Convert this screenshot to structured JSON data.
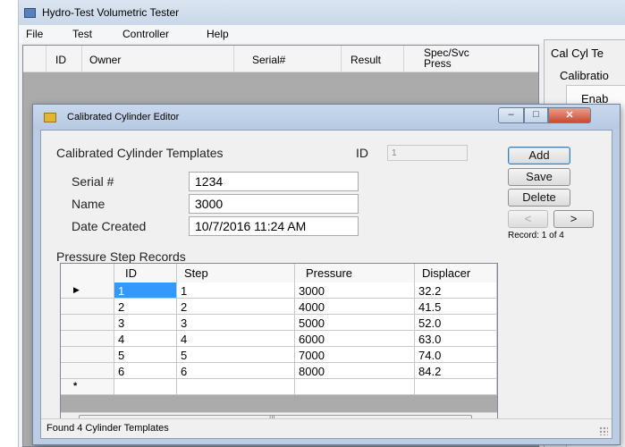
{
  "main_window": {
    "title": "Hydro-Test Volumetric Tester",
    "menu": [
      "File",
      "Test",
      "Controller",
      "Help"
    ],
    "grid_headers": [
      "ID",
      "Owner",
      "Serial#",
      "Result",
      "Spec/Svc Press"
    ],
    "right_panel": {
      "title": "Cal Cyl Te",
      "subtitle": "Calibratio",
      "enable_label": "Enab"
    }
  },
  "dialog": {
    "title": "Calibrated Cylinder Editor",
    "window_controls": {
      "minimize": "–",
      "maximize": "□",
      "close": "✕"
    },
    "section_title": "Calibrated Cylinder Templates",
    "id_label": "ID",
    "id_value": "1",
    "fields": {
      "serial_label": "Serial #",
      "serial_value": "1234",
      "name_label": "Name",
      "name_value": "3000",
      "date_label": "Date Created",
      "date_value": "10/7/2016 11:24 AM"
    },
    "buttons": {
      "add": "Add",
      "save": "Save",
      "delete": "Delete",
      "prev": "<",
      "next": ">"
    },
    "record_status": "Record: 1 of 4",
    "pressure_title": "Pressure Step Records",
    "pressure_grid": {
      "headers": [
        "ID",
        "Step",
        "Pressure",
        "Displacer"
      ],
      "rows": [
        [
          "1",
          "1",
          "3000",
          "32.2"
        ],
        [
          "2",
          "2",
          "4000",
          "41.5"
        ],
        [
          "3",
          "3",
          "5000",
          "52.0"
        ],
        [
          "4",
          "4",
          "6000",
          "63.0"
        ],
        [
          "5",
          "5",
          "7000",
          "74.0"
        ],
        [
          "6",
          "6",
          "8000",
          "84.2"
        ]
      ],
      "current_row_marker": "▶",
      "new_row_marker": "*",
      "scroll_left": "◄",
      "scroll_right": "►",
      "scroll_grip": "III"
    },
    "status_text": "Found 4 Cylinder Templates"
  }
}
